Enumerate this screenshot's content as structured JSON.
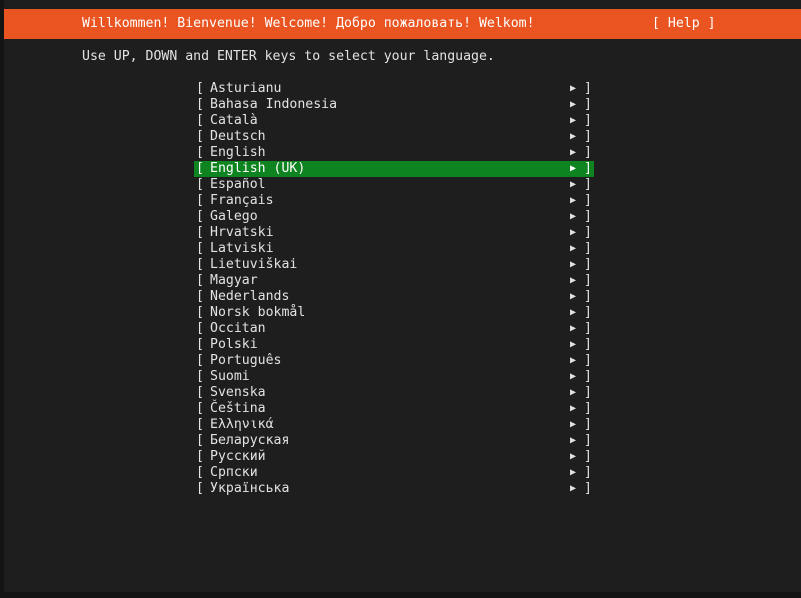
{
  "header": {
    "title": "Willkommen! Bienvenue! Welcome! Добро пожаловать! Welkom!",
    "help_label": "[ Help ]"
  },
  "instructions": "Use UP, DOWN and ENTER keys to select your language.",
  "list": {
    "open_bracket": "[",
    "close_bracket": "]",
    "arrow": "▶",
    "selected_index": 5,
    "items": [
      "Asturianu",
      "Bahasa Indonesia",
      "Català",
      "Deutsch",
      "English",
      "English (UK)",
      "Español",
      "Français",
      "Galego",
      "Hrvatski",
      "Latviski",
      "Lietuviškai",
      "Magyar",
      "Nederlands",
      "Norsk bokmål",
      "Occitan",
      "Polski",
      "Português",
      "Suomi",
      "Svenska",
      "Čeština",
      "Ελληνικά",
      "Беларуская",
      "Русский",
      "Српски",
      "Українська"
    ]
  },
  "colors": {
    "header_bg": "#e95420",
    "selected_bg": "#0e8420",
    "background": "#1e1e1e",
    "text": "#e2e2e2"
  },
  "icons": {
    "arrow": "arrow-right-icon"
  }
}
